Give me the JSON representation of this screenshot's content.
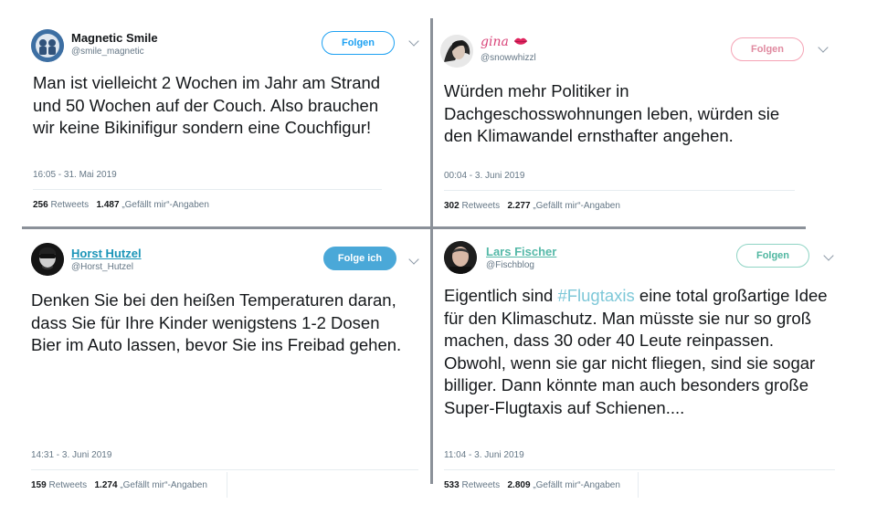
{
  "tweets": [
    {
      "name": "Magnetic Smile",
      "handle": "@smile_magnetic",
      "follow_label": "Folgen",
      "text": "Man ist vielleicht 2 Wochen im Jahr am Strand und 50 Wochen auf der Couch. Also brauchen wir keine Bikinifigur sondern eine Couchfigur!",
      "timestamp": "16:05 - 31. Mai 2019",
      "retweets": "256",
      "retweets_label": "Retweets",
      "likes": "1.487",
      "likes_label": "„Gefällt mir“-Angaben"
    },
    {
      "name": "gina",
      "handle": "@snowwhizzl",
      "follow_label": "Folgen",
      "text": "Würden mehr Politiker in Dachgeschosswohnungen leben, würden sie den Klimawandel ernsthafter angehen.",
      "timestamp": "00:04 - 3. Juni 2019",
      "retweets": "302",
      "retweets_label": "Retweets",
      "likes": "2.277",
      "likes_label": "„Gefällt mir“-Angaben"
    },
    {
      "name": "Horst Hutzel",
      "handle": "@Horst_Hutzel",
      "follow_label": "Folge ich",
      "text": "Denken Sie bei den heißen Temperaturen daran, dass Sie für Ihre Kinder wenigstens 1-2 Dosen Bier im Auto lassen, bevor Sie ins Freibad gehen.",
      "timestamp": "14:31 - 3. Juni 2019",
      "retweets": "159",
      "retweets_label": "Retweets",
      "likes": "1.274",
      "likes_label": "„Gefällt mir“-Angaben"
    },
    {
      "name": "Lars Fischer",
      "handle": "@Fischblog",
      "follow_label": "Folgen",
      "text_before": "Eigentlich sind ",
      "hashtag": "#Flugtaxis",
      "text_after": " eine total großartige Idee für den Klimaschutz. Man müsste sie nur so groß machen, dass 30 oder 40 Leute reinpassen. Obwohl, wenn sie gar nicht fliegen, sind sie sogar billiger. Dann könnte man auch besonders große  Super-Flugtaxis auf Schienen....",
      "timestamp": "11:04 - 3. Juni 2019",
      "retweets": "533",
      "retweets_label": "Retweets",
      "likes": "2.809",
      "likes_label": "„Gefällt mir“-Angaben"
    }
  ],
  "colors": {
    "accent": "#1da1f2",
    "hashtag": "#7ec8d8",
    "divider": "#8b9199"
  }
}
